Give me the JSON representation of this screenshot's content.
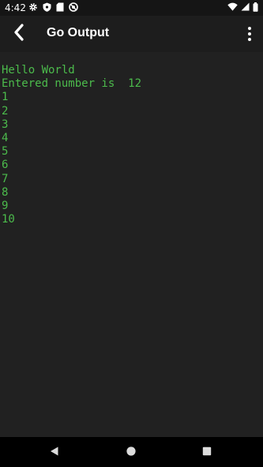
{
  "status_bar": {
    "time": "4:42",
    "left_icons": [
      "gear-icon",
      "shield-icon",
      "sd-card-icon",
      "no-sync-icon"
    ],
    "right_icons": [
      "wifi-icon",
      "signal-icon",
      "battery-icon"
    ]
  },
  "toolbar": {
    "title": "Go Output",
    "back_icon": "chevron-left-icon",
    "menu_icon": "more-vertical-icon"
  },
  "console": {
    "text_color": "#4cbb4c",
    "lines": [
      "Hello World",
      "Entered number is  12",
      "1",
      "2",
      "3",
      "4",
      "5",
      "6",
      "7",
      "8",
      "9",
      "10"
    ]
  },
  "nav_bar": {
    "buttons": [
      "back-triangle-icon",
      "home-circle-icon",
      "recents-square-icon"
    ]
  }
}
